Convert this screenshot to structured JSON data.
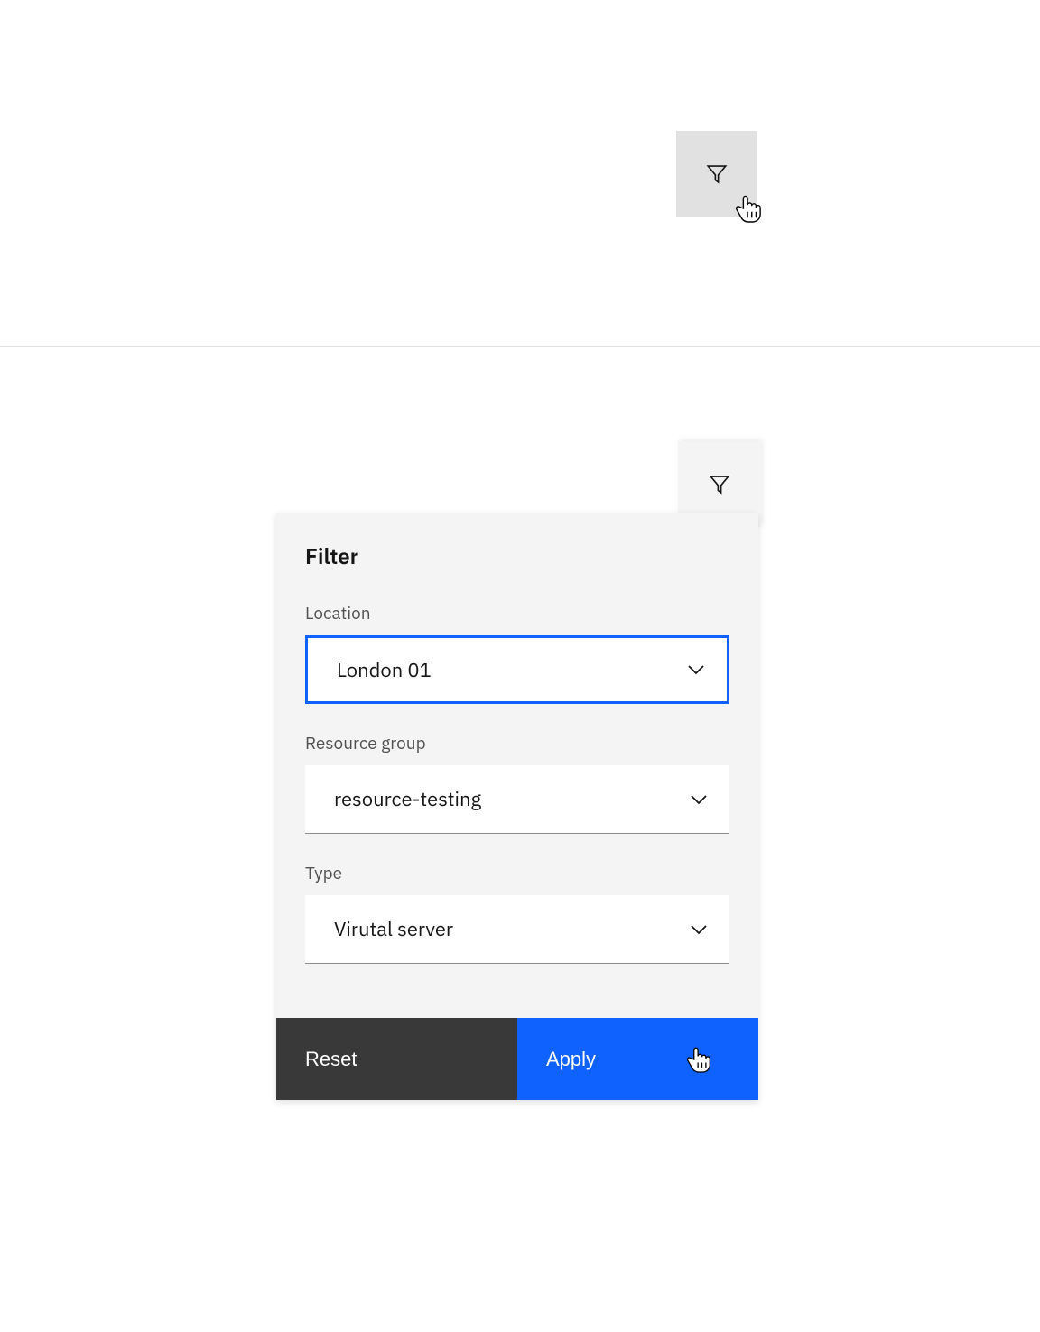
{
  "filter": {
    "title": "Filter",
    "fields": {
      "location": {
        "label": "Location",
        "value": "London 01"
      },
      "resource_group": {
        "label": "Resource group",
        "value": "resource-testing"
      },
      "type": {
        "label": "Type",
        "value": "Virutal server"
      }
    },
    "buttons": {
      "reset": "Reset",
      "apply": "Apply"
    }
  },
  "colors": {
    "primary": "#0f62fe",
    "panel_bg": "#f4f4f4",
    "secondary_btn": "#393939"
  }
}
